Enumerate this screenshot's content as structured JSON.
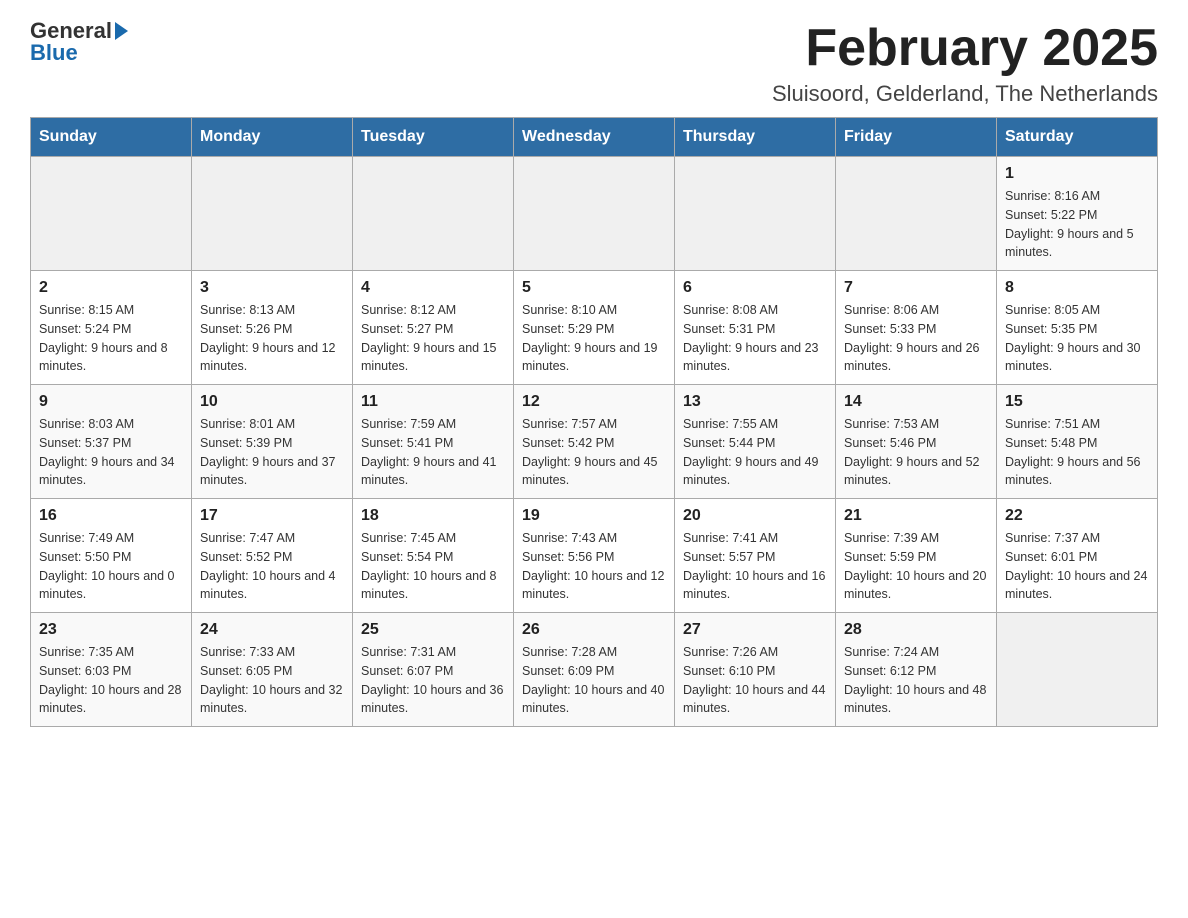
{
  "header": {
    "logo_general": "General",
    "logo_blue": "Blue",
    "month_title": "February 2025",
    "subtitle": "Sluisoord, Gelderland, The Netherlands"
  },
  "days_of_week": [
    "Sunday",
    "Monday",
    "Tuesday",
    "Wednesday",
    "Thursday",
    "Friday",
    "Saturday"
  ],
  "weeks": [
    [
      {
        "day": "",
        "info": ""
      },
      {
        "day": "",
        "info": ""
      },
      {
        "day": "",
        "info": ""
      },
      {
        "day": "",
        "info": ""
      },
      {
        "day": "",
        "info": ""
      },
      {
        "day": "",
        "info": ""
      },
      {
        "day": "1",
        "info": "Sunrise: 8:16 AM\nSunset: 5:22 PM\nDaylight: 9 hours and 5 minutes."
      }
    ],
    [
      {
        "day": "2",
        "info": "Sunrise: 8:15 AM\nSunset: 5:24 PM\nDaylight: 9 hours and 8 minutes."
      },
      {
        "day": "3",
        "info": "Sunrise: 8:13 AM\nSunset: 5:26 PM\nDaylight: 9 hours and 12 minutes."
      },
      {
        "day": "4",
        "info": "Sunrise: 8:12 AM\nSunset: 5:27 PM\nDaylight: 9 hours and 15 minutes."
      },
      {
        "day": "5",
        "info": "Sunrise: 8:10 AM\nSunset: 5:29 PM\nDaylight: 9 hours and 19 minutes."
      },
      {
        "day": "6",
        "info": "Sunrise: 8:08 AM\nSunset: 5:31 PM\nDaylight: 9 hours and 23 minutes."
      },
      {
        "day": "7",
        "info": "Sunrise: 8:06 AM\nSunset: 5:33 PM\nDaylight: 9 hours and 26 minutes."
      },
      {
        "day": "8",
        "info": "Sunrise: 8:05 AM\nSunset: 5:35 PM\nDaylight: 9 hours and 30 minutes."
      }
    ],
    [
      {
        "day": "9",
        "info": "Sunrise: 8:03 AM\nSunset: 5:37 PM\nDaylight: 9 hours and 34 minutes."
      },
      {
        "day": "10",
        "info": "Sunrise: 8:01 AM\nSunset: 5:39 PM\nDaylight: 9 hours and 37 minutes."
      },
      {
        "day": "11",
        "info": "Sunrise: 7:59 AM\nSunset: 5:41 PM\nDaylight: 9 hours and 41 minutes."
      },
      {
        "day": "12",
        "info": "Sunrise: 7:57 AM\nSunset: 5:42 PM\nDaylight: 9 hours and 45 minutes."
      },
      {
        "day": "13",
        "info": "Sunrise: 7:55 AM\nSunset: 5:44 PM\nDaylight: 9 hours and 49 minutes."
      },
      {
        "day": "14",
        "info": "Sunrise: 7:53 AM\nSunset: 5:46 PM\nDaylight: 9 hours and 52 minutes."
      },
      {
        "day": "15",
        "info": "Sunrise: 7:51 AM\nSunset: 5:48 PM\nDaylight: 9 hours and 56 minutes."
      }
    ],
    [
      {
        "day": "16",
        "info": "Sunrise: 7:49 AM\nSunset: 5:50 PM\nDaylight: 10 hours and 0 minutes."
      },
      {
        "day": "17",
        "info": "Sunrise: 7:47 AM\nSunset: 5:52 PM\nDaylight: 10 hours and 4 minutes."
      },
      {
        "day": "18",
        "info": "Sunrise: 7:45 AM\nSunset: 5:54 PM\nDaylight: 10 hours and 8 minutes."
      },
      {
        "day": "19",
        "info": "Sunrise: 7:43 AM\nSunset: 5:56 PM\nDaylight: 10 hours and 12 minutes."
      },
      {
        "day": "20",
        "info": "Sunrise: 7:41 AM\nSunset: 5:57 PM\nDaylight: 10 hours and 16 minutes."
      },
      {
        "day": "21",
        "info": "Sunrise: 7:39 AM\nSunset: 5:59 PM\nDaylight: 10 hours and 20 minutes."
      },
      {
        "day": "22",
        "info": "Sunrise: 7:37 AM\nSunset: 6:01 PM\nDaylight: 10 hours and 24 minutes."
      }
    ],
    [
      {
        "day": "23",
        "info": "Sunrise: 7:35 AM\nSunset: 6:03 PM\nDaylight: 10 hours and 28 minutes."
      },
      {
        "day": "24",
        "info": "Sunrise: 7:33 AM\nSunset: 6:05 PM\nDaylight: 10 hours and 32 minutes."
      },
      {
        "day": "25",
        "info": "Sunrise: 7:31 AM\nSunset: 6:07 PM\nDaylight: 10 hours and 36 minutes."
      },
      {
        "day": "26",
        "info": "Sunrise: 7:28 AM\nSunset: 6:09 PM\nDaylight: 10 hours and 40 minutes."
      },
      {
        "day": "27",
        "info": "Sunrise: 7:26 AM\nSunset: 6:10 PM\nDaylight: 10 hours and 44 minutes."
      },
      {
        "day": "28",
        "info": "Sunrise: 7:24 AM\nSunset: 6:12 PM\nDaylight: 10 hours and 48 minutes."
      },
      {
        "day": "",
        "info": ""
      }
    ]
  ]
}
